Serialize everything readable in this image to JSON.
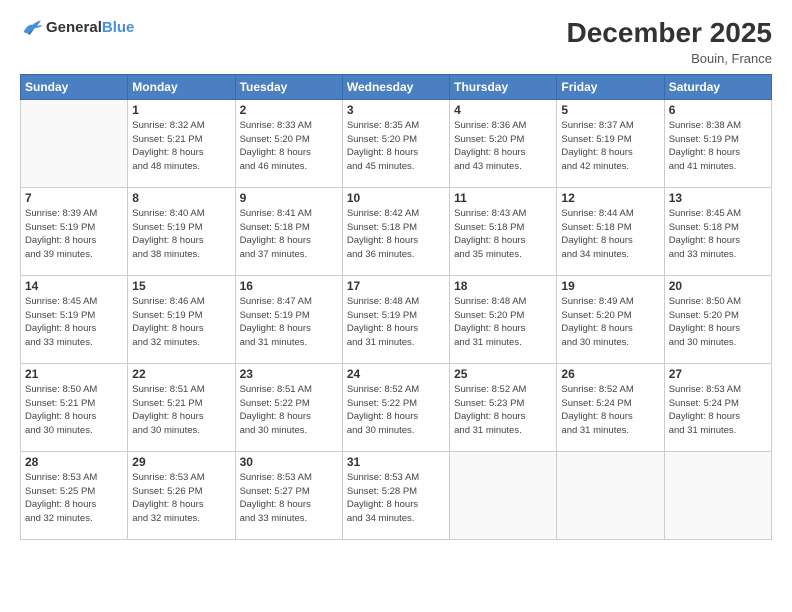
{
  "logo": {
    "general": "General",
    "blue": "Blue"
  },
  "title": "December 2025",
  "subtitle": "Bouin, France",
  "header_days": [
    "Sunday",
    "Monday",
    "Tuesday",
    "Wednesday",
    "Thursday",
    "Friday",
    "Saturday"
  ],
  "weeks": [
    [
      {
        "day": "",
        "info": ""
      },
      {
        "day": "1",
        "info": "Sunrise: 8:32 AM\nSunset: 5:21 PM\nDaylight: 8 hours\nand 48 minutes."
      },
      {
        "day": "2",
        "info": "Sunrise: 8:33 AM\nSunset: 5:20 PM\nDaylight: 8 hours\nand 46 minutes."
      },
      {
        "day": "3",
        "info": "Sunrise: 8:35 AM\nSunset: 5:20 PM\nDaylight: 8 hours\nand 45 minutes."
      },
      {
        "day": "4",
        "info": "Sunrise: 8:36 AM\nSunset: 5:20 PM\nDaylight: 8 hours\nand 43 minutes."
      },
      {
        "day": "5",
        "info": "Sunrise: 8:37 AM\nSunset: 5:19 PM\nDaylight: 8 hours\nand 42 minutes."
      },
      {
        "day": "6",
        "info": "Sunrise: 8:38 AM\nSunset: 5:19 PM\nDaylight: 8 hours\nand 41 minutes."
      }
    ],
    [
      {
        "day": "7",
        "info": "Sunrise: 8:39 AM\nSunset: 5:19 PM\nDaylight: 8 hours\nand 39 minutes."
      },
      {
        "day": "8",
        "info": "Sunrise: 8:40 AM\nSunset: 5:19 PM\nDaylight: 8 hours\nand 38 minutes."
      },
      {
        "day": "9",
        "info": "Sunrise: 8:41 AM\nSunset: 5:18 PM\nDaylight: 8 hours\nand 37 minutes."
      },
      {
        "day": "10",
        "info": "Sunrise: 8:42 AM\nSunset: 5:18 PM\nDaylight: 8 hours\nand 36 minutes."
      },
      {
        "day": "11",
        "info": "Sunrise: 8:43 AM\nSunset: 5:18 PM\nDaylight: 8 hours\nand 35 minutes."
      },
      {
        "day": "12",
        "info": "Sunrise: 8:44 AM\nSunset: 5:18 PM\nDaylight: 8 hours\nand 34 minutes."
      },
      {
        "day": "13",
        "info": "Sunrise: 8:45 AM\nSunset: 5:18 PM\nDaylight: 8 hours\nand 33 minutes."
      }
    ],
    [
      {
        "day": "14",
        "info": "Sunrise: 8:45 AM\nSunset: 5:19 PM\nDaylight: 8 hours\nand 33 minutes."
      },
      {
        "day": "15",
        "info": "Sunrise: 8:46 AM\nSunset: 5:19 PM\nDaylight: 8 hours\nand 32 minutes."
      },
      {
        "day": "16",
        "info": "Sunrise: 8:47 AM\nSunset: 5:19 PM\nDaylight: 8 hours\nand 31 minutes."
      },
      {
        "day": "17",
        "info": "Sunrise: 8:48 AM\nSunset: 5:19 PM\nDaylight: 8 hours\nand 31 minutes."
      },
      {
        "day": "18",
        "info": "Sunrise: 8:48 AM\nSunset: 5:20 PM\nDaylight: 8 hours\nand 31 minutes."
      },
      {
        "day": "19",
        "info": "Sunrise: 8:49 AM\nSunset: 5:20 PM\nDaylight: 8 hours\nand 30 minutes."
      },
      {
        "day": "20",
        "info": "Sunrise: 8:50 AM\nSunset: 5:20 PM\nDaylight: 8 hours\nand 30 minutes."
      }
    ],
    [
      {
        "day": "21",
        "info": "Sunrise: 8:50 AM\nSunset: 5:21 PM\nDaylight: 8 hours\nand 30 minutes."
      },
      {
        "day": "22",
        "info": "Sunrise: 8:51 AM\nSunset: 5:21 PM\nDaylight: 8 hours\nand 30 minutes."
      },
      {
        "day": "23",
        "info": "Sunrise: 8:51 AM\nSunset: 5:22 PM\nDaylight: 8 hours\nand 30 minutes."
      },
      {
        "day": "24",
        "info": "Sunrise: 8:52 AM\nSunset: 5:22 PM\nDaylight: 8 hours\nand 30 minutes."
      },
      {
        "day": "25",
        "info": "Sunrise: 8:52 AM\nSunset: 5:23 PM\nDaylight: 8 hours\nand 31 minutes."
      },
      {
        "day": "26",
        "info": "Sunrise: 8:52 AM\nSunset: 5:24 PM\nDaylight: 8 hours\nand 31 minutes."
      },
      {
        "day": "27",
        "info": "Sunrise: 8:53 AM\nSunset: 5:24 PM\nDaylight: 8 hours\nand 31 minutes."
      }
    ],
    [
      {
        "day": "28",
        "info": "Sunrise: 8:53 AM\nSunset: 5:25 PM\nDaylight: 8 hours\nand 32 minutes."
      },
      {
        "day": "29",
        "info": "Sunrise: 8:53 AM\nSunset: 5:26 PM\nDaylight: 8 hours\nand 32 minutes."
      },
      {
        "day": "30",
        "info": "Sunrise: 8:53 AM\nSunset: 5:27 PM\nDaylight: 8 hours\nand 33 minutes."
      },
      {
        "day": "31",
        "info": "Sunrise: 8:53 AM\nSunset: 5:28 PM\nDaylight: 8 hours\nand 34 minutes."
      },
      {
        "day": "",
        "info": ""
      },
      {
        "day": "",
        "info": ""
      },
      {
        "day": "",
        "info": ""
      }
    ]
  ],
  "colors": {
    "header_bg": "#4a7fc1",
    "header_text": "#ffffff",
    "accent": "#4a90d9"
  }
}
